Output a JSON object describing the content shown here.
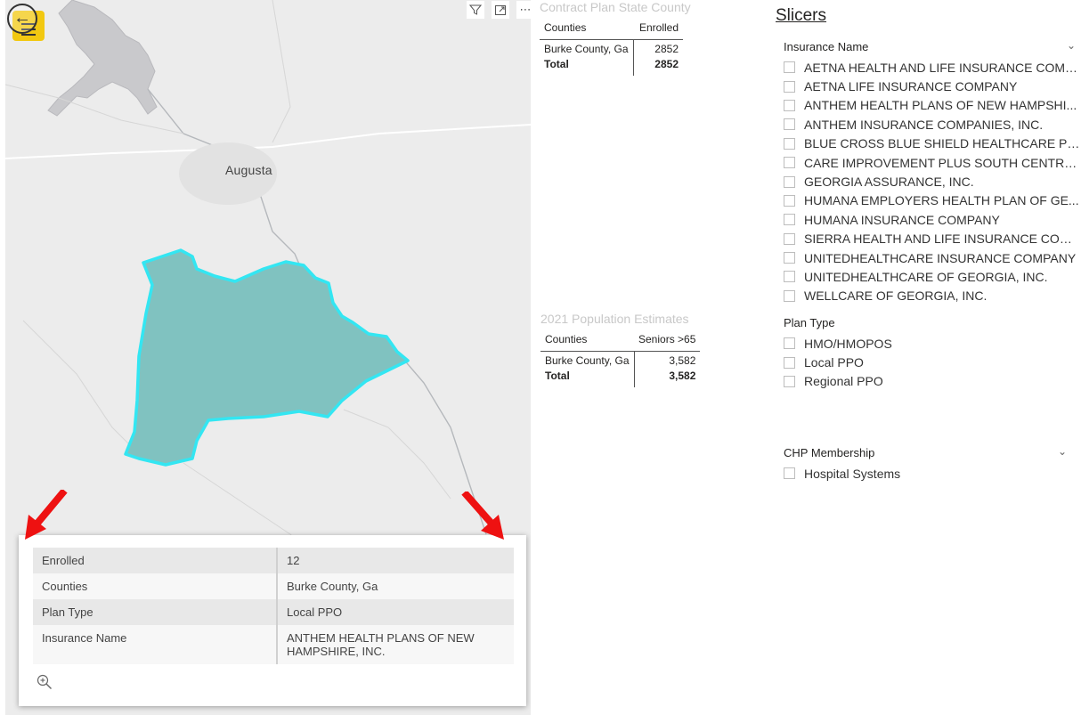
{
  "map": {
    "city_label": "Augusta",
    "back_icon": "back-arrow-icon",
    "menu_icon": "hamburger-menu-icon",
    "toolbar": [
      "filter-icon",
      "focus-mode-icon",
      "more-options-icon"
    ],
    "region_fill": "#80c2c0",
    "region_outline": "#33e6f2",
    "tooltip": {
      "rows": [
        {
          "key": "Enrolled",
          "value": "12"
        },
        {
          "key": "Counties",
          "value": "Burke County, Ga"
        },
        {
          "key": "Plan Type",
          "value": "Local PPO"
        },
        {
          "key": "Insurance Name",
          "value": "ANTHEM HEALTH PLANS OF NEW HAMPSHIRE, INC."
        }
      ],
      "zoom_icon": "zoom-in-icon"
    },
    "arrow_color": "#ee1111"
  },
  "contract_table": {
    "title": "Contract Plan State County",
    "headers": [
      "Counties",
      "Enrolled"
    ],
    "rows": [
      {
        "county": "Burke County, Ga",
        "value": "2852"
      }
    ],
    "total": {
      "label": "Total",
      "value": "2852"
    }
  },
  "population_table": {
    "title": "2021 Population Estimates",
    "headers": [
      "Counties",
      "Seniors >65"
    ],
    "rows": [
      {
        "county": "Burke County, Ga",
        "value": "3,582"
      }
    ],
    "total": {
      "label": "Total",
      "value": "3,582"
    }
  },
  "slicers": {
    "title": "Slicers",
    "insurance": {
      "header": "Insurance Name",
      "items": [
        "AETNA HEALTH AND LIFE INSURANCE COMP...",
        "AETNA LIFE INSURANCE COMPANY",
        "ANTHEM HEALTH PLANS OF NEW HAMPSHI...",
        "ANTHEM INSURANCE COMPANIES, INC.",
        "BLUE CROSS BLUE SHIELD HEALTHCARE PLA...",
        "CARE IMPROVEMENT PLUS SOUTH CENTRAL ...",
        "GEORGIA ASSURANCE, INC.",
        "HUMANA EMPLOYERS HEALTH PLAN OF GE...",
        "HUMANA INSURANCE COMPANY",
        "SIERRA HEALTH AND LIFE INSURANCE COMP...",
        "UNITEDHEALTHCARE INSURANCE COMPANY",
        "UNITEDHEALTHCARE OF GEORGIA, INC.",
        "WELLCARE OF GEORGIA, INC."
      ]
    },
    "plan_type": {
      "header": "Plan Type",
      "items": [
        "HMO/HMOPOS",
        "Local PPO",
        "Regional PPO"
      ]
    },
    "chp": {
      "header": "CHP Membership",
      "items": [
        "Hospital Systems"
      ]
    }
  }
}
